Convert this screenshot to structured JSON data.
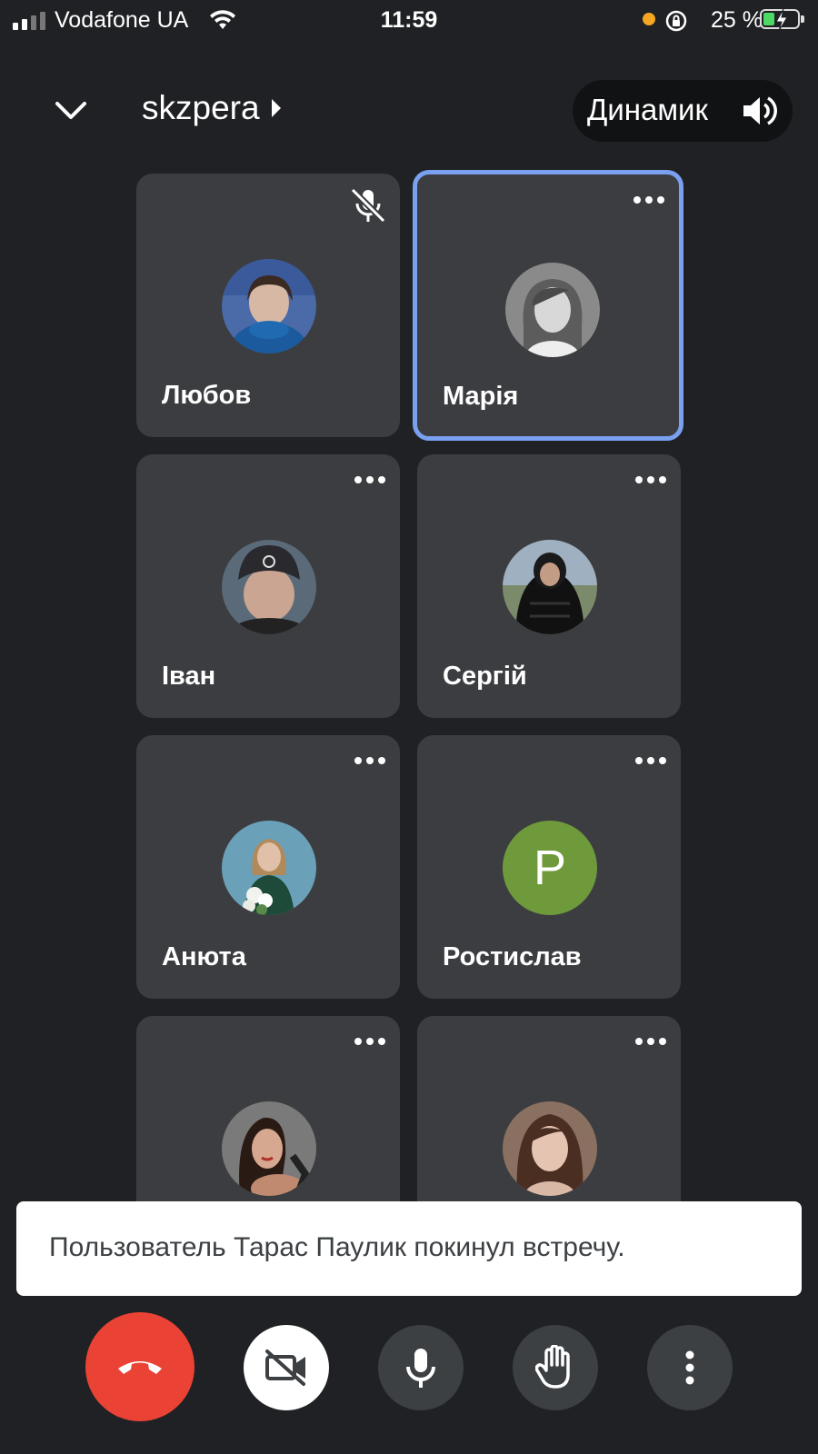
{
  "status_bar": {
    "carrier": "Vodafone UA",
    "time": "11:59",
    "battery_percent": "25 %"
  },
  "header": {
    "meeting_title": "skzpera",
    "audio_output": "Динамик"
  },
  "participants": [
    {
      "name": "Любов",
      "muted": true,
      "active": false
    },
    {
      "name": "Марія",
      "muted": false,
      "active": true
    },
    {
      "name": "Іван",
      "muted": false,
      "active": false
    },
    {
      "name": "Сергій",
      "muted": false,
      "active": false
    },
    {
      "name": "Анюта",
      "muted": false,
      "active": false
    },
    {
      "name": "Ростислав",
      "muted": false,
      "active": false,
      "initial": "P",
      "avatar_color": "#6f9a3b"
    },
    {
      "name": "",
      "muted": false,
      "active": false
    },
    {
      "name": "",
      "muted": false,
      "active": false
    }
  ],
  "toast": {
    "message": "Пользователь Тарас Паулик покинул встречу."
  },
  "controls": {
    "end_call_color": "#ea4335",
    "icons": [
      "phone-hangup-icon",
      "camera-off-icon",
      "mic-icon",
      "raise-hand-icon",
      "more-vertical-icon"
    ]
  },
  "colors": {
    "background": "#202124",
    "tile": "#3c3d40",
    "active_border": "#7aa0f0"
  }
}
